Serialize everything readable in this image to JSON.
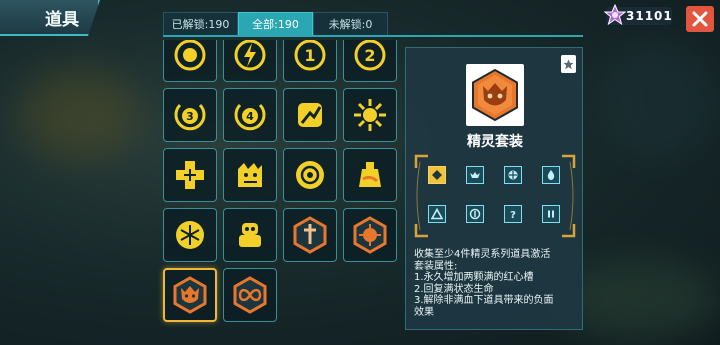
{
  "header": {
    "title": "道具"
  },
  "filters": [
    {
      "label": "已解锁:190"
    },
    {
      "label": "全部:190"
    },
    {
      "label": "未解锁:0"
    }
  ],
  "currency": {
    "amount": "31101",
    "icon": "star-gem-icon"
  },
  "close": {
    "icon": "close-icon"
  },
  "grid": {
    "items": [
      {
        "icon": "flame-ring-icon"
      },
      {
        "icon": "lightning-ring-icon"
      },
      {
        "icon": "badge-1-icon"
      },
      {
        "icon": "badge-2-icon"
      },
      {
        "icon": "badge-3-icon"
      },
      {
        "icon": "badge-4-icon"
      },
      {
        "icon": "cracked-rune-icon"
      },
      {
        "icon": "sun-icon"
      },
      {
        "icon": "cross-plus-icon"
      },
      {
        "icon": "monster-block-icon"
      },
      {
        "icon": "gear-eye-icon"
      },
      {
        "icon": "potion-icon"
      },
      {
        "icon": "snowflake-ring-icon"
      },
      {
        "icon": "robot-icon"
      },
      {
        "icon": "sword-hex-icon"
      },
      {
        "icon": "spiked-sun-hex-icon"
      },
      {
        "icon": "fairy-face-hex-icon"
      },
      {
        "icon": "infinity-hex-icon"
      }
    ],
    "selected_index": 16
  },
  "detail": {
    "name": "精灵套装",
    "icon": "fairy-face-icon",
    "small_icon": "star-badge-icon",
    "set_items": [
      {
        "icon": "diamond-set-icon",
        "lit": true
      },
      {
        "icon": "bat-set-icon",
        "lit": false
      },
      {
        "icon": "orb-set-icon",
        "lit": false
      },
      {
        "icon": "drop-set-icon",
        "lit": false
      },
      {
        "icon": "triangle-set-icon",
        "lit": false
      },
      {
        "icon": "cross-orb-set-icon",
        "lit": false
      },
      {
        "icon": "question-set-icon",
        "lit": false
      },
      {
        "icon": "pause-set-icon",
        "lit": false
      }
    ],
    "description": [
      "收集至少4件精灵系列道具激活",
      "套装属性:",
      "1.永久增加两颗满的红心槽",
      "2.回复满状态生命",
      "3.解除非满血下道具带来的负面",
      "效果"
    ]
  },
  "colors": {
    "accent": "#2aa7b3",
    "selected": "#f0b838",
    "item_yellow": "#f2d028",
    "item_orange": "#e8772c",
    "close": "#e2563f"
  }
}
